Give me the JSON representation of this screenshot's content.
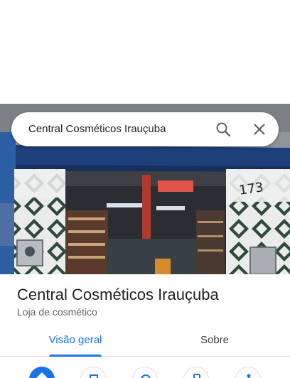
{
  "search": {
    "query": "Central Cosméticos Irauçuba",
    "search_icon": "search-icon",
    "close_icon": "close-icon"
  },
  "place": {
    "name": "Central Cosméticos Irauçuba",
    "category": "Loja de cosmético",
    "house_number": "173"
  },
  "tabs": [
    {
      "label": "Visão geral",
      "selected": true
    },
    {
      "label": "Sobre",
      "selected": false
    }
  ],
  "actions": [
    {
      "icon": "directions-icon",
      "primary": true
    },
    {
      "icon": "save-icon",
      "primary": false
    },
    {
      "icon": "nearby-icon",
      "primary": false
    },
    {
      "icon": "phone-icon",
      "primary": false
    },
    {
      "icon": "share-icon",
      "primary": false
    }
  ],
  "colors": {
    "accent": "#1a73e8",
    "text_primary": "#202124",
    "text_secondary": "#5f6368",
    "divider": "#dadce0"
  }
}
